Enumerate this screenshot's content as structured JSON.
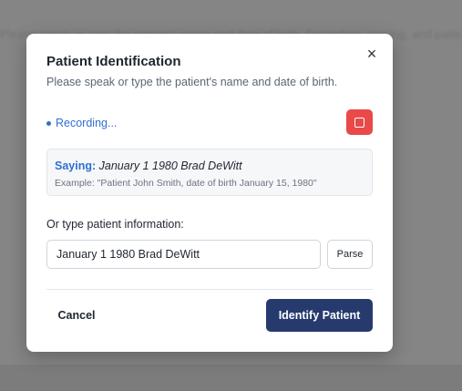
{
  "background": {
    "text": "Please speak or type the patient's name and date of birth. Recording, parsing, and patient matching"
  },
  "modal": {
    "title": "Patient Identification",
    "subtitle": "Please speak or type the patient's name and date of birth.",
    "close_icon": "close-icon",
    "close_glyph": "×"
  },
  "recording": {
    "status": "Recording...",
    "stop_icon": "stop-icon",
    "stop_color": "#e94949"
  },
  "saying": {
    "label": "Saying:",
    "text": "January 1 1980 Brad DeWitt",
    "example": "Example: \"Patient John Smith, date of birth January 15, 1980\""
  },
  "manual": {
    "label": "Or type patient information:",
    "value": "January 1 1980 Brad DeWitt",
    "parse_label": "Parse"
  },
  "footer": {
    "cancel_label": "Cancel",
    "identify_label": "Identify Patient"
  },
  "colors": {
    "accent": "#2f6fd1",
    "primary_button": "#263a6e",
    "stop_button": "#e94949"
  }
}
